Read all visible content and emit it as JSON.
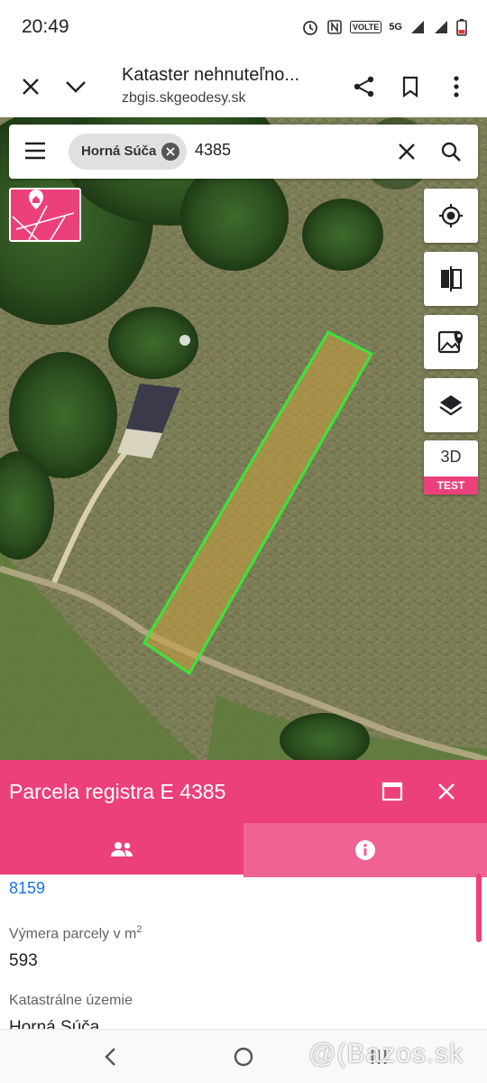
{
  "status_bar": {
    "time": "20:49",
    "volte": "VOLTE",
    "network": "5G"
  },
  "browser": {
    "title": "Kataster nehnuteľno...",
    "url": "zbgis.skgeodesy.sk"
  },
  "search": {
    "chip_label": "Horná Súča",
    "query": "4385"
  },
  "map_controls": {
    "three_d_label": "3D",
    "three_d_badge": "TEST"
  },
  "parcel_panel": {
    "title": "Parcela registra E 4385",
    "link_value": "8159",
    "area_label": "Výmera parcely v m",
    "area_sup": "2",
    "area_value": "593",
    "cadastral_label": "Katastrálne územie",
    "cadastral_value": "Horná Súča"
  },
  "watermark": "@(Bazos.sk",
  "colors": {
    "accent": "#ec407a",
    "parcel_outline": "#39e639",
    "parcel_fill": "#c8a040",
    "link": "#1a73e8"
  }
}
